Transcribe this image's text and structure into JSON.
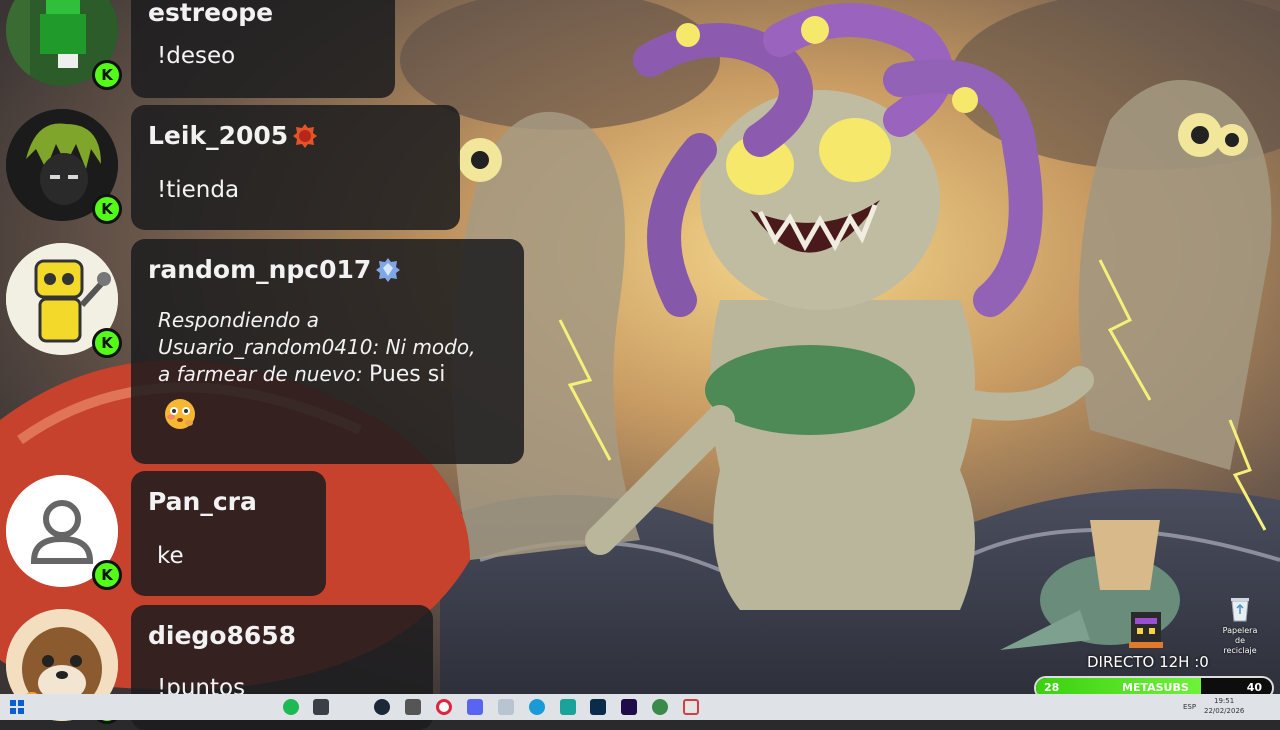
{
  "chat": {
    "messages": [
      {
        "username": "estreope",
        "text": "!deseo",
        "badge": "K",
        "avatar": "minecraft-green-character"
      },
      {
        "username": "Leik_2005",
        "text": "!tienda",
        "badge": "K",
        "avatar": "anime-green-hair-character",
        "user_badge": "red-shield-icon"
      },
      {
        "username": "random_npc017",
        "badge": "K",
        "avatar": "yellow-robot",
        "user_badge": "blue-gem-icon",
        "reply_prefix": "Respondiendo a",
        "reply_target": "Usuario_random0410: Ni modo,",
        "reply_quote": "a farmear de nuevo:",
        "text": "Pues si",
        "emoji": "flushed-thinking-emoji"
      },
      {
        "username": "Pan_cra",
        "text": "ke",
        "badge": "K",
        "avatar": "default-user-silhouette"
      },
      {
        "username": "diego8658",
        "text": "!puntos",
        "badge": "K",
        "avatar": "cartoon-otter"
      }
    ]
  },
  "overlay": {
    "directo_text": "DIRECTO 12H :0",
    "goal": {
      "label": "METASUBS",
      "current": "28",
      "target": "40",
      "progress": 0.7
    }
  },
  "desktop": {
    "recycle_bin_label": "Papelera de reciclaje"
  },
  "taskbar": {
    "lang": "ESP",
    "time": "19:51",
    "date": "22/02/2026"
  },
  "colors": {
    "kick_green": "#53fc18",
    "bubble_bg": "#1c1c1e",
    "taskbar_bg": "#dfe3e8"
  }
}
